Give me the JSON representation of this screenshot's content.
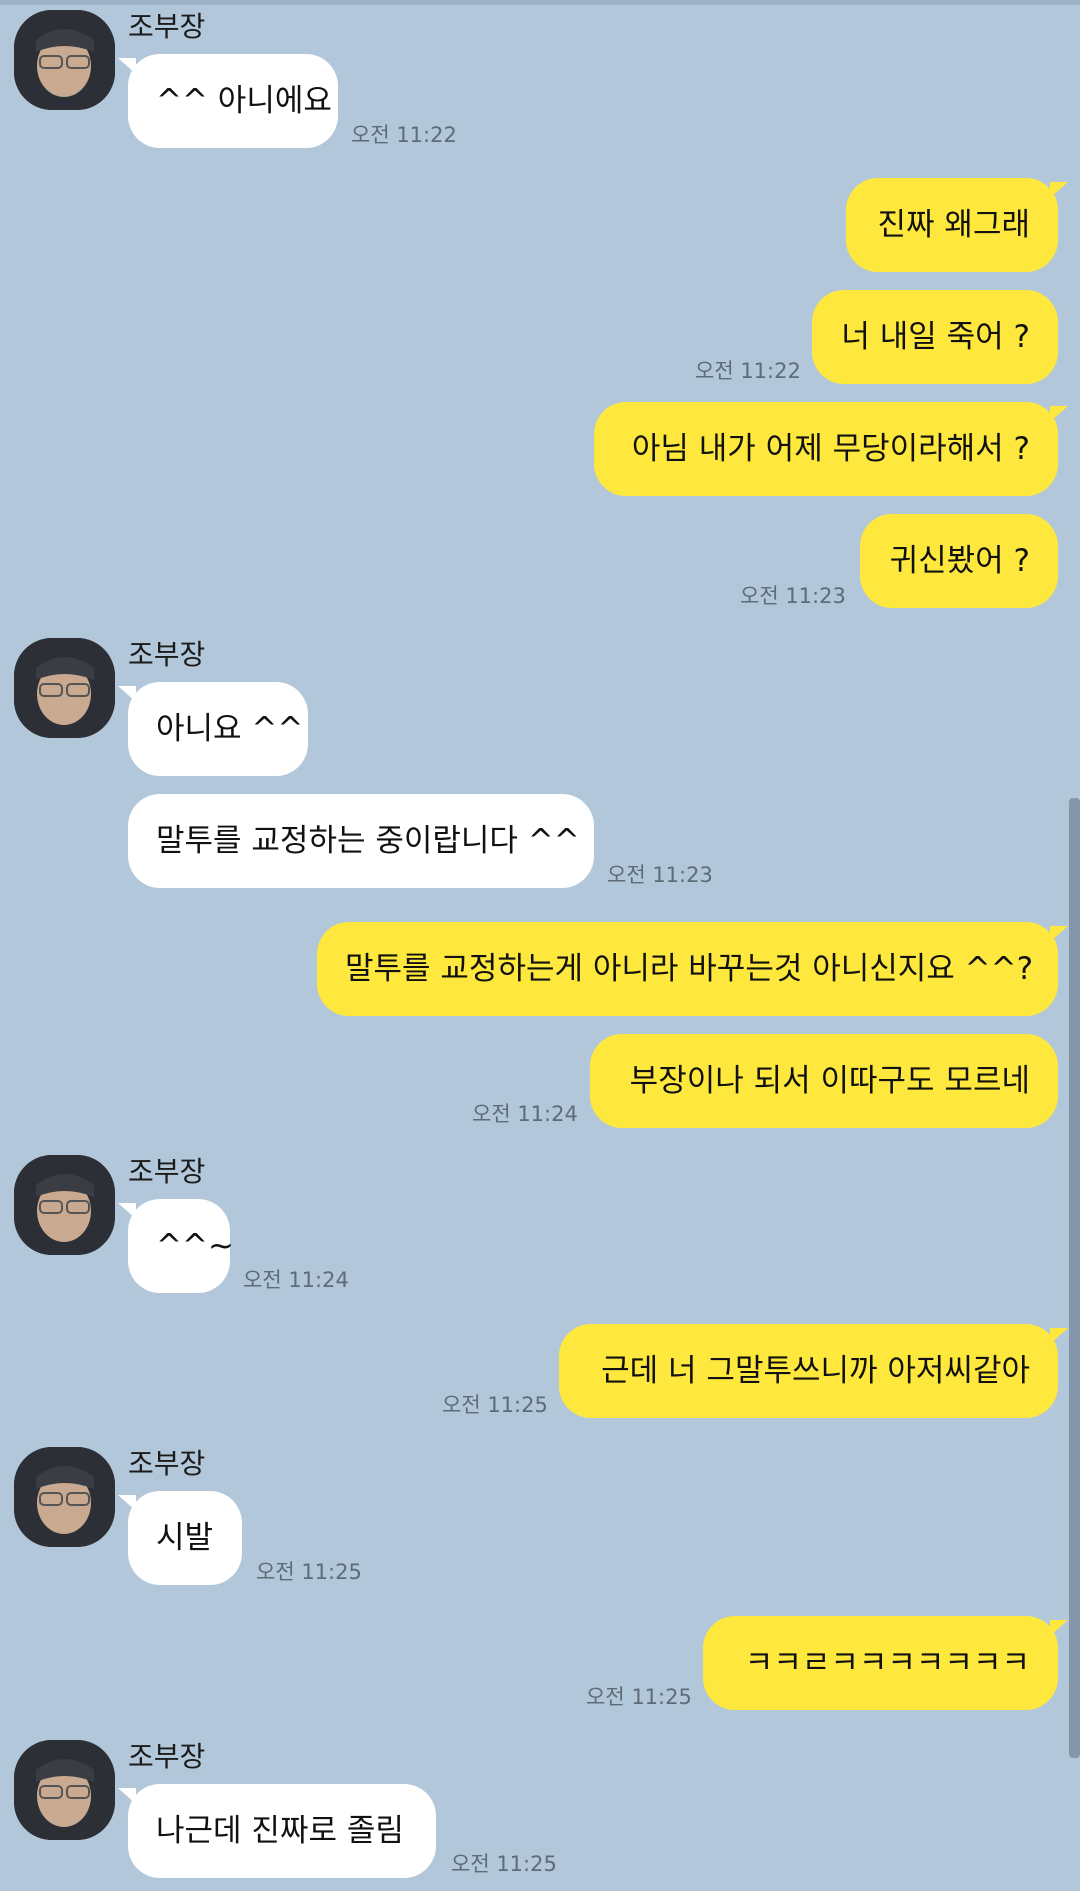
{
  "colors": {
    "background": "#b2c7da",
    "incoming_bubble": "#ffffff",
    "outgoing_bubble": "#fee83d",
    "time_text": "#5f6b76"
  },
  "sender_name": "조부장",
  "messages": [
    {
      "dir": "in",
      "text": "^^ 아니에요",
      "time": "오전 11:22"
    },
    {
      "dir": "out",
      "text": "진짜 왜그래",
      "time": ""
    },
    {
      "dir": "out",
      "text": "너 내일 죽어 ?",
      "time": "오전 11:22"
    },
    {
      "dir": "out",
      "text": "아님 내가 어제 무당이라해서 ?",
      "time": ""
    },
    {
      "dir": "out",
      "text": "귀신봤어 ?",
      "time": "오전 11:23"
    },
    {
      "dir": "in",
      "text": "아니요 ^^",
      "time": ""
    },
    {
      "dir": "in",
      "text": "말투를 교정하는 중이랍니다 ^^",
      "time": "오전 11:23"
    },
    {
      "dir": "out",
      "text": "말투를 교정하는게 아니라 바꾸는것 아니신지요 ^^?",
      "time": ""
    },
    {
      "dir": "out",
      "text": "부장이나 되서 이따구도 모르네",
      "time": "오전 11:24"
    },
    {
      "dir": "in",
      "text": "^^~",
      "time": "오전 11:24"
    },
    {
      "dir": "out",
      "text": "근데 너 그말투쓰니까 아저씨같아",
      "time": "오전 11:25"
    },
    {
      "dir": "in",
      "text": "시발",
      "time": "오전 11:25"
    },
    {
      "dir": "out",
      "text": "ㅋㅋㄹㅋㅋㅋㅋㅋㅋㅋ",
      "time": "오전 11:25"
    },
    {
      "dir": "in",
      "text": "나근데 진짜로 졸림",
      "time": "오전 11:25"
    }
  ]
}
